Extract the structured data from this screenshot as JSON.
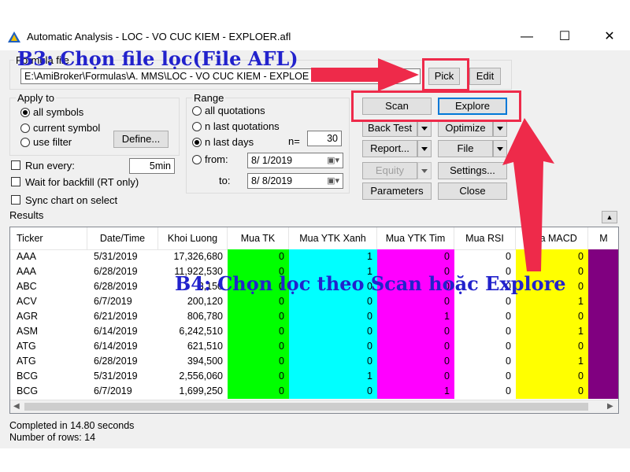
{
  "window": {
    "title": "Automatic Analysis - LOC - VO CUC KIEM - EXPLOER.afl",
    "minimize": "—",
    "maximize": "☐",
    "close": "✕"
  },
  "formula": {
    "label": "Formula file",
    "path": "E:\\AmiBroker\\Formulas\\A. MMS\\LOC - VO CUC KIEM - EXPLOE",
    "pick": "Pick",
    "edit": "Edit"
  },
  "apply_to": {
    "label": "Apply to",
    "all_symbols": "all symbols",
    "current_symbol": "current symbol",
    "use_filter": "use filter",
    "define": "Define..."
  },
  "range": {
    "label": "Range",
    "all_quotations": "all quotations",
    "n_last_quotations": "n last quotations",
    "n_last_days": "n last days",
    "n_label": "n=",
    "n_value": "30",
    "from_label": "from:",
    "from_value": "8/  1/2019",
    "to_label": "to:",
    "to_value": "8/  8/2019"
  },
  "options": {
    "run_every": "Run every:",
    "run_every_value": "5min",
    "wait_backfill": "Wait for backfill (RT only)",
    "sync_chart": "Sync chart on select"
  },
  "actions": {
    "scan": "Scan",
    "explore": "Explore",
    "back_test": "Back Test",
    "optimize": "Optimize",
    "report": "Report...",
    "file": "File",
    "equity": "Equity",
    "settings": "Settings...",
    "parameters": "Parameters",
    "close": "Close"
  },
  "results": {
    "label": "Results",
    "columns": [
      "Ticker",
      "Date/Time",
      "Khoi Luong",
      "Mua TK",
      "Mua YTK Xanh",
      "Mua YTK Tim",
      "Mua RSI",
      "Mua MACD",
      "M"
    ],
    "rows": [
      [
        "AAA",
        "5/31/2019",
        "17,326,680",
        "0",
        "1",
        "0",
        "0",
        "0"
      ],
      [
        "AAA",
        "6/28/2019",
        "11,922,530",
        "0",
        "1",
        "0",
        "0",
        "0"
      ],
      [
        "ABC",
        "6/28/2019",
        "3,150",
        "0",
        "0",
        "0",
        "0",
        "0"
      ],
      [
        "ACV",
        "6/7/2019",
        "200,120",
        "0",
        "0",
        "0",
        "0",
        "1"
      ],
      [
        "AGR",
        "6/21/2019",
        "806,780",
        "0",
        "0",
        "1",
        "0",
        "0"
      ],
      [
        "ASM",
        "6/14/2019",
        "6,242,510",
        "0",
        "0",
        "0",
        "0",
        "1"
      ],
      [
        "ATG",
        "6/14/2019",
        "621,510",
        "0",
        "0",
        "0",
        "0",
        "0"
      ],
      [
        "ATG",
        "6/28/2019",
        "394,500",
        "0",
        "0",
        "0",
        "0",
        "1"
      ],
      [
        "BCG",
        "5/31/2019",
        "2,556,060",
        "0",
        "1",
        "0",
        "0",
        "0"
      ],
      [
        "BCG",
        "6/7/2019",
        "1,699,250",
        "0",
        "0",
        "1",
        "0",
        "0"
      ]
    ]
  },
  "status": {
    "completed": "Completed in 14.80 seconds",
    "rows": "Number of rows: 14"
  },
  "annotations": {
    "step3": "B3: Chọn file lọc(File AFL)",
    "step4": "B4: Chọn lọc theo Scan hoặc Explore"
  },
  "colors": {
    "mua_tk": "#00ff00",
    "mua_ytk_xanh": "#00ffff",
    "mua_ytk_tim": "#ff00ff",
    "mua_macd": "#ffff00",
    "last_col": "#800080",
    "annotation_text": "#2222cc",
    "annotation_highlight": "#ee2a4a"
  }
}
